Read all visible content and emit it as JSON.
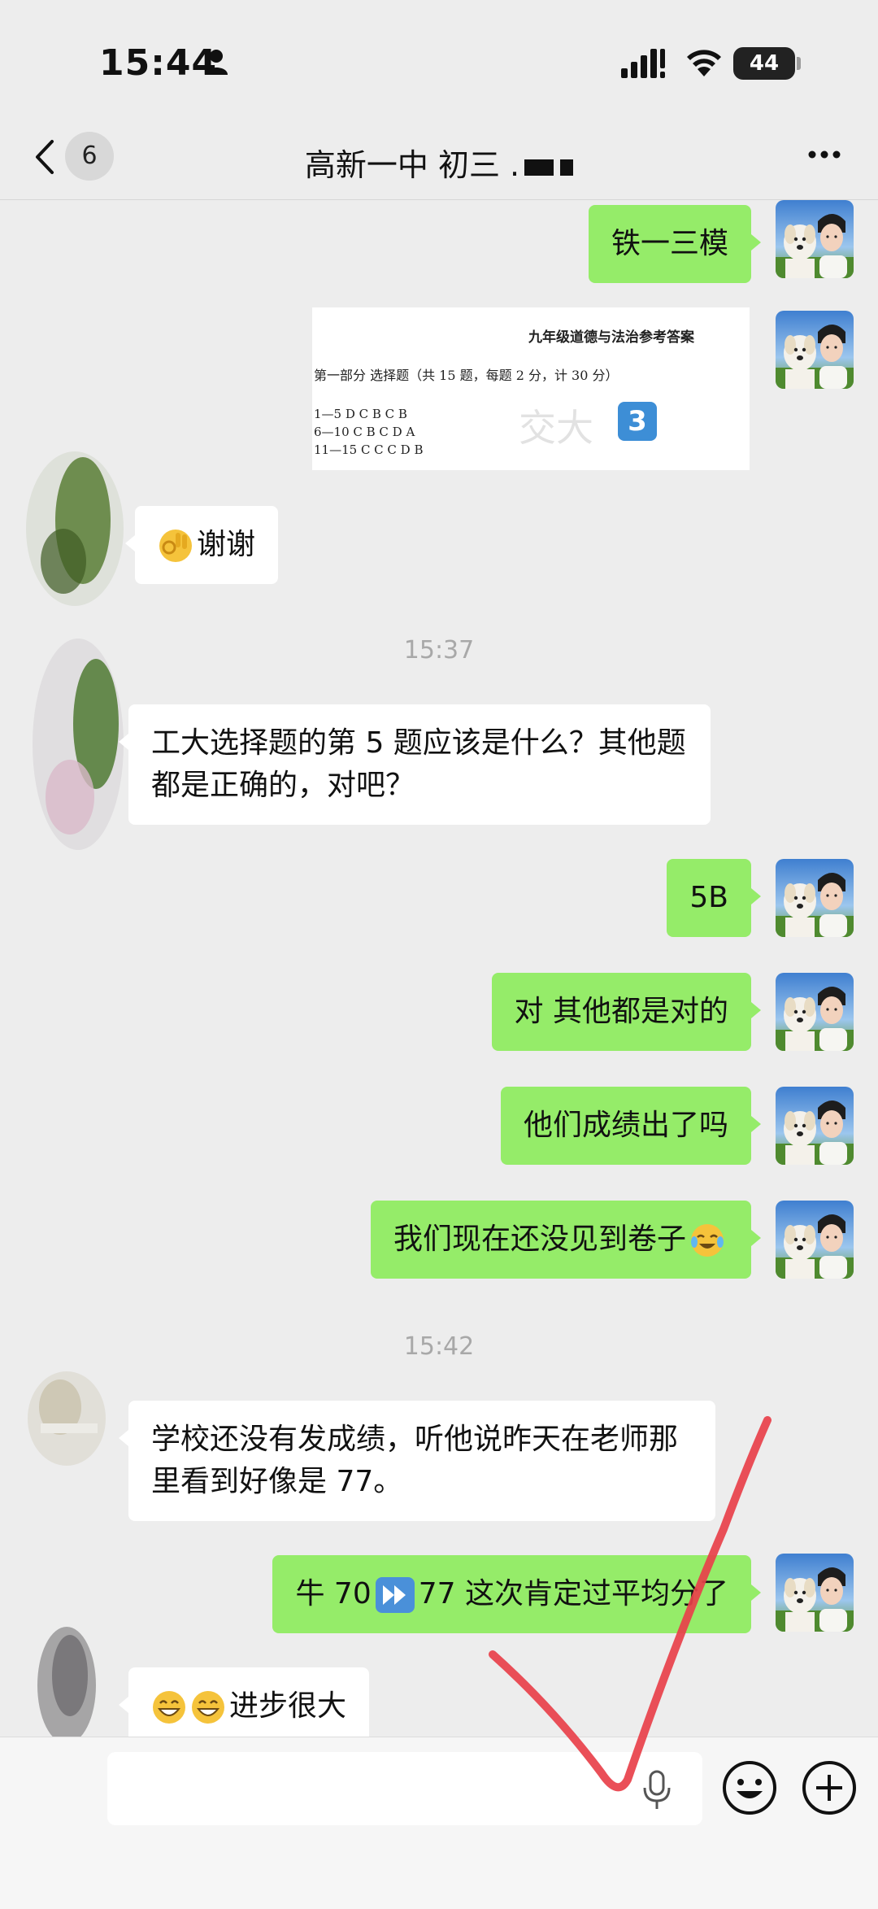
{
  "status_bar": {
    "time": "15:44",
    "battery": "44"
  },
  "nav": {
    "unread_count": "6",
    "title": "高新一中 初三 ."
  },
  "messages": {
    "m1": "铁一三模",
    "image": {
      "heading": "九年级道德与法治参考答案",
      "section": "第一部分 选择题（共 15 题，每题 2 分，计 30 分）",
      "row1": "1—5 D C B C B",
      "row2": "6—10 C B C D A",
      "row3": "11—15 C C C D B",
      "watermark": "交大",
      "badge": "3"
    },
    "m2": "谢谢",
    "time1": "15:37",
    "m3": "工大选择题的第 5 题应该是什么？其他题都是正确的，对吧？",
    "m4": "5B",
    "m5": "对 其他都是对的",
    "m6": "他们成绩出了吗",
    "m7": "我们现在还没见到卷子",
    "time2": "15:42",
    "m8": "学校还没有发成绩，听他说昨天在老师那里看到好像是 77。",
    "m9a": "牛 70",
    "m9b": "77 这次肯定过平均分了",
    "m10": "进步很大"
  },
  "icons": {
    "back": "chevron-left-icon",
    "more": "more-dots-icon",
    "mic": "microphone-icon",
    "emoji": "emoji-icon",
    "plus": "plus-icon"
  },
  "colors": {
    "sent_bubble": "#95ec69",
    "received_bubble": "#ffffff",
    "background": "#ededed",
    "check_mark": "#e8404a"
  }
}
